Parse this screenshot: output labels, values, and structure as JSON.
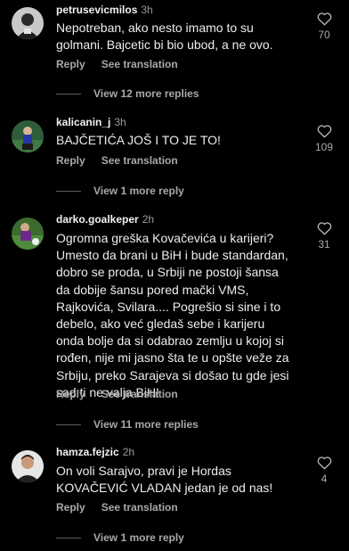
{
  "comments": [
    {
      "username": "petrusevicmilos",
      "time": "3h",
      "text": "Nepotreban, ako nesto imamo to su golmani. Bajcetic bi bio ubod, a ne ovo.",
      "reply_label": "Reply",
      "translate_label": "See translation",
      "likes": "70",
      "more_replies": "View 12 more replies"
    },
    {
      "username": "kalicanin_j",
      "time": "3h",
      "text": "BAJČETIĆA JOŠ I TO JE TO!",
      "reply_label": "Reply",
      "translate_label": "See translation",
      "likes": "109",
      "more_replies": "View 1 more reply"
    },
    {
      "username": "darko.goalkeper",
      "time": "2h",
      "text": "Ogromna greška Kovačevića u karijeri? Umesto da brani u BiH i bude standardan, dobro se proda, u Srbiji ne postoji šansa da dobije šansu pored mački VMS, Rajkovića, Svilara.... Pogrešio si sine i to debelo, ako već gledaš sebe i karijeru onda bolje da si odabrao zemlju u kojoj si rođen, nije mi jasno šta te u opšte veže za Srbiju, preko Sarajeva si došao tu gde jesi sad ti ne valja BiH!",
      "reply_label": "Reply",
      "translate_label": "See translation",
      "likes": "31",
      "more_replies": "View 11 more replies"
    },
    {
      "username": "hamza.fejzic",
      "time": "2h",
      "text": "On voli Sarajvo, pravi je Hordas KOVAČEVIĆ VLADAN jedan je od nas!",
      "reply_label": "Reply",
      "translate_label": "See translation",
      "likes": "4",
      "more_replies": "View 1 more reply"
    }
  ],
  "icons": {
    "like": "heart-outline-icon"
  },
  "colors": {
    "background": "#000000",
    "primary_text": "#ededed",
    "secondary_text": "#a8a8a8"
  }
}
